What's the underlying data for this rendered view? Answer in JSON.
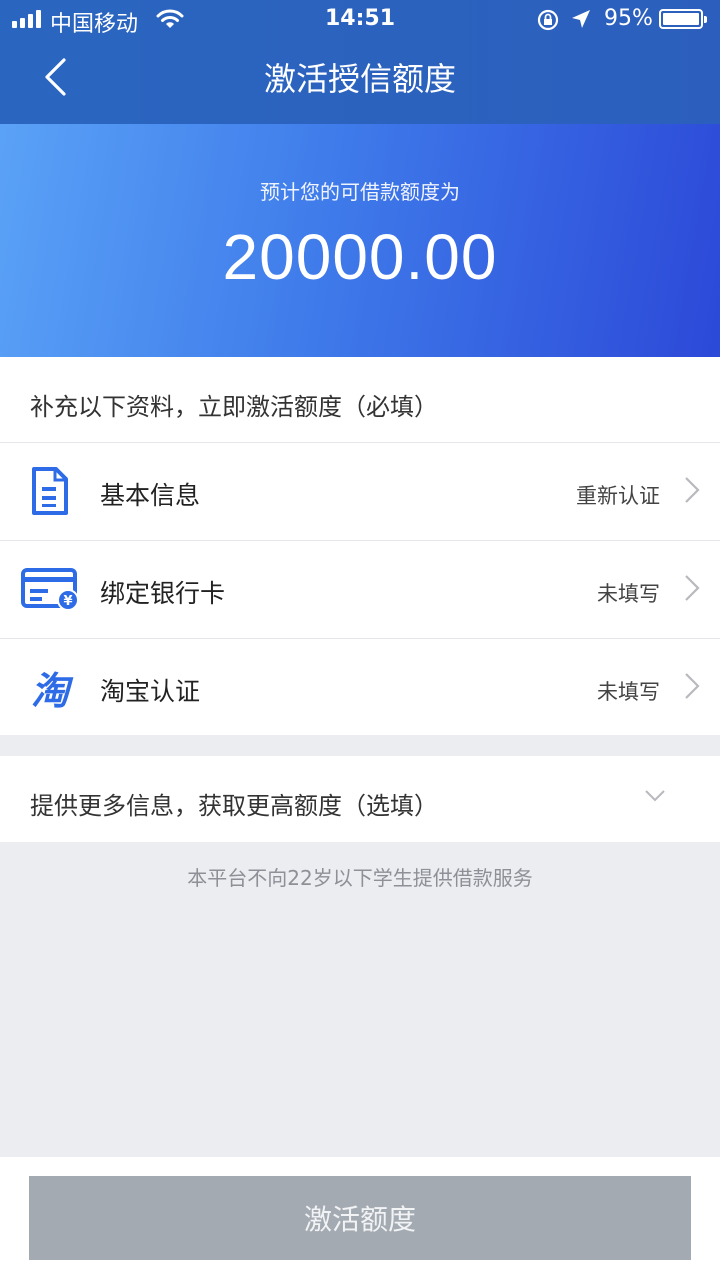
{
  "status_bar": {
    "carrier": "中国移动",
    "time": "14:51",
    "battery_percent": "95%",
    "icons": [
      "signal-icon",
      "wifi-icon",
      "rotation-lock-icon",
      "location-arrow-icon",
      "battery-icon"
    ]
  },
  "nav": {
    "title": "激活授信额度",
    "back_icon": "chevron-left-icon"
  },
  "hero": {
    "label": "预计您的可借款额度为",
    "amount": "20000.00"
  },
  "required": {
    "header": "补充以下资料，立即激活额度（必填）",
    "items": [
      {
        "label": "基本信息",
        "status": "重新认证",
        "icon": "document-icon"
      },
      {
        "label": "绑定银行卡",
        "status": "未填写",
        "icon": "bank-card-icon"
      },
      {
        "label": "淘宝认证",
        "status": "未填写",
        "icon": "taobao-icon",
        "icon_text": "淘"
      }
    ]
  },
  "optional": {
    "label": "提供更多信息，获取更高额度（选填）"
  },
  "notice": "本平台不向22岁以下学生提供借款服务",
  "action": {
    "label": "激活额度"
  },
  "colors": {
    "nav_bg": "#2C62BF",
    "hero_start": "#5AA2F7",
    "hero_end": "#2C49D8",
    "icon_blue": "#2E6BE6",
    "page_bg": "#ECEDF1",
    "button_disabled": "#A3AAB2"
  }
}
